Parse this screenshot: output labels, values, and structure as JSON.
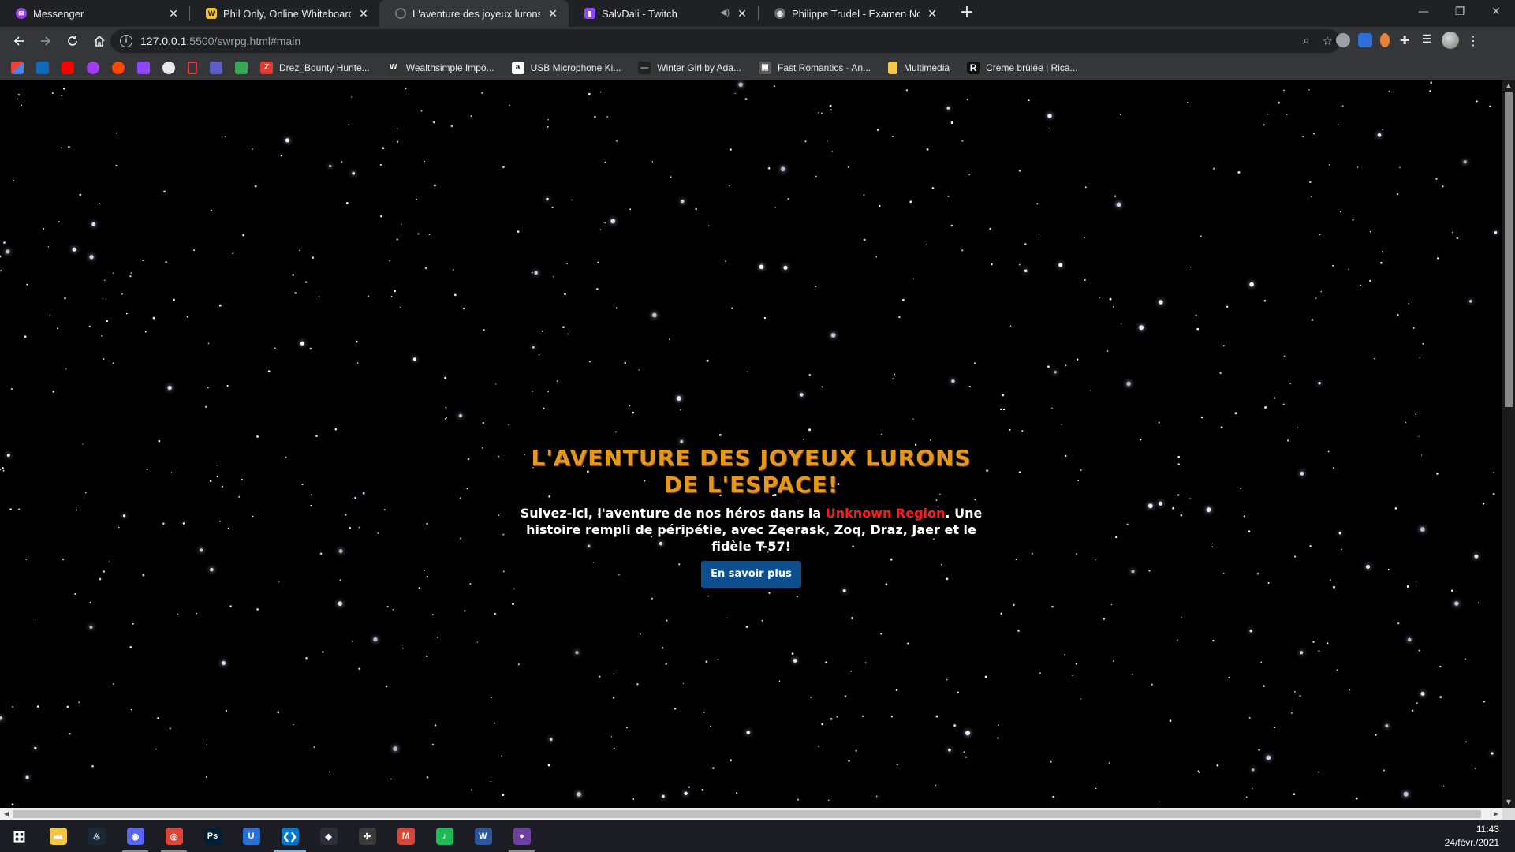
{
  "browser": {
    "tabs": [
      {
        "title": "Messenger",
        "icon": "messenger-icon",
        "color": "#9b3cf0",
        "active": false
      },
      {
        "title": "Phil Only, Online Whiteboard for",
        "icon": "whiteboard-icon",
        "color": "#f2c12e",
        "active": false
      },
      {
        "title": "L'aventure des joyeux lurons",
        "icon": "loading-icon",
        "color": "#555555",
        "active": true
      },
      {
        "title": "SalvDali - Twitch",
        "icon": "twitch-icon",
        "color": "#9146ff",
        "active": false,
        "audio": true
      },
      {
        "title": "Philippe Trudel - Examen Noovo",
        "icon": "globe-icon",
        "color": "#7a7a7a",
        "active": false
      }
    ],
    "new_tab_label": "+",
    "window_controls": {
      "minimize": "—",
      "restore": "❐",
      "close": "✕"
    },
    "address": {
      "host": "127.0.0.1",
      "path": ":5500/swrpg.html#main"
    },
    "bookmarks": [
      {
        "label": "Drez_Bounty Hunte...",
        "color": "#e63b2e",
        "glyph": "Z"
      },
      {
        "label": "Wealthsimple Impô...",
        "color": "#333333",
        "glyph": "W"
      },
      {
        "label": "USB Microphone Ki...",
        "color": "#ffffff",
        "glyph": "a"
      },
      {
        "label": "Winter Girl by Ada...",
        "color": "#222222",
        "glyph": "▬"
      },
      {
        "label": "Fast Romantics - An...",
        "color": "#5a5a5a",
        "glyph": "▣"
      },
      {
        "label": "Multimédia",
        "color": "#f2c94c",
        "glyph": ""
      },
      {
        "label": "Crème brûlée | Rica...",
        "color": "#111111",
        "glyph": "R"
      }
    ],
    "bookmark_icons": [
      {
        "name": "gmail-icon",
        "color": "#ea4335"
      },
      {
        "name": "outlook-icon",
        "color": "#0f6cbd"
      },
      {
        "name": "youtube-icon",
        "color": "#ff0000"
      },
      {
        "name": "messenger-icon",
        "color": "#a33bf0"
      },
      {
        "name": "reddit-icon",
        "color": "#ff4500"
      },
      {
        "name": "twitch-icon",
        "color": "#9146ff"
      },
      {
        "name": "chatgpt-icon",
        "color": "#e8e8e8"
      },
      {
        "name": "phone-icon",
        "color": "#e03a3a"
      },
      {
        "name": "teams-icon",
        "color": "#5b5fc7"
      },
      {
        "name": "map-icon",
        "color": "#3aa757"
      }
    ]
  },
  "page": {
    "title": "L'aventure des joyeux lurons de l'espace!",
    "text_before": "Suivez-ici, l'aventure de nos héros dans la ",
    "highlight": "Unknown Region",
    "text_after": ". Une histoire rempli de péripétie, avec Zeerask, Zoq, Draz, Jaer et le fidèle T-57!",
    "button": "En savoir plus",
    "colors": {
      "title": "#e6971e",
      "highlight": "#ff1a1a",
      "button": "#0c4f8c"
    }
  },
  "taskbar": {
    "apps": [
      {
        "name": "start-button",
        "label": "⊞",
        "color": "transparent",
        "state": ""
      },
      {
        "name": "file-explorer-icon",
        "label": "▬",
        "color": "#f4c542",
        "state": ""
      },
      {
        "name": "steam-icon",
        "label": "♨",
        "color": "#1b2838",
        "state": ""
      },
      {
        "name": "discord-icon",
        "label": "◉",
        "color": "#5865f2",
        "state": "open"
      },
      {
        "name": "chrome-icon",
        "label": "◎",
        "color": "#db4437",
        "state": "open"
      },
      {
        "name": "photoshop-icon",
        "label": "Ps",
        "color": "#001e36",
        "state": ""
      },
      {
        "name": "uplay-icon",
        "label": "U",
        "color": "#2a6fd6",
        "state": ""
      },
      {
        "name": "vscode-icon",
        "label": "❮❯",
        "color": "#0078d4",
        "state": "active"
      },
      {
        "name": "game-launcher-icon",
        "label": "◆",
        "color": "#2b2d3a",
        "state": ""
      },
      {
        "name": "davinci-icon",
        "label": "✣",
        "color": "#3a3a3a",
        "state": ""
      },
      {
        "name": "gmail-icon",
        "label": "M",
        "color": "#d44638",
        "state": ""
      },
      {
        "name": "spotify-icon",
        "label": "♪",
        "color": "#1db954",
        "state": ""
      },
      {
        "name": "word-icon",
        "label": "W",
        "color": "#2b579a",
        "state": ""
      },
      {
        "name": "obs-icon",
        "label": "●",
        "color": "#6c3fa0",
        "state": "open"
      }
    ],
    "time": "11:43",
    "date": "24/févr./2021"
  }
}
